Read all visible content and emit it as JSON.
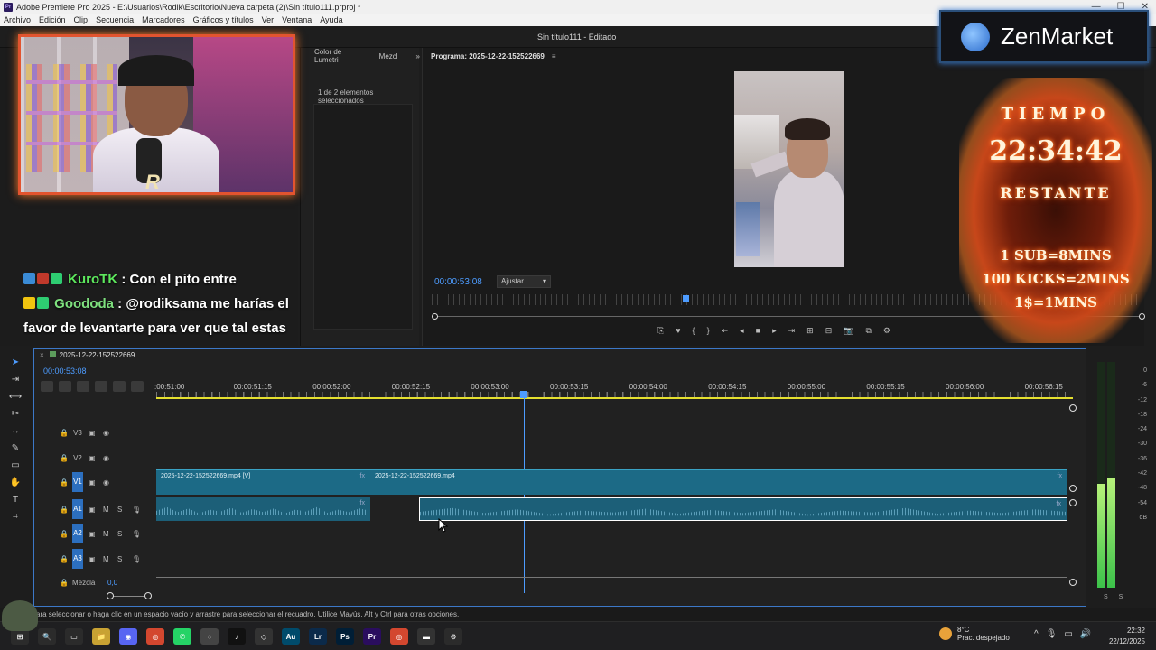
{
  "window": {
    "title": "Adobe Premiere Pro 2025 - E:\\Usuarios\\Rodik\\Escritorio\\Nueva carpeta (2)\\Sin título111.prproj *",
    "app_badge": "Pr",
    "controls": [
      "—",
      "☐",
      "✕"
    ]
  },
  "menu": [
    "Archivo",
    "Edición",
    "Clip",
    "Secuencia",
    "Marcadores",
    "Gráficos y títulos",
    "Ver",
    "Ventana",
    "Ayuda"
  ],
  "project_title": "Sin título111 - Editado",
  "mid_panel": {
    "tabs": [
      "Color de Lumetri",
      "Mezcl"
    ],
    "more": "»",
    "selection": "1 de 2 elementos seleccionados"
  },
  "program_monitor": {
    "header": "Programa: 2025-12-22-152522669",
    "menu_icon": "≡",
    "timecode": "00:00:53:08",
    "zoom_select": "Ajustar",
    "controls": [
      "⎘",
      "♥",
      "{",
      "}",
      "⇤",
      "◂",
      "■",
      "▸",
      "⇥",
      "⊞",
      "⊟",
      "📷",
      "⧉",
      "⚙"
    ]
  },
  "timeline": {
    "sequence_name": "2025-12-22-152522669",
    "close": "×",
    "timecode": "00:00:53:08",
    "ruler_labels": [
      ":00:51:00",
      "00:00:51:15",
      "00:00:52:00",
      "00:00:52:15",
      "00:00:53:00",
      "00:00:53:15",
      "00:00:54:00",
      "00:00:54:15",
      "00:00:55:00",
      "00:00:55:15",
      "00:00:56:00",
      "00:00:56:15"
    ],
    "tracks": [
      {
        "name": "V3",
        "active": false,
        "icons": [
          "▣",
          "◉"
        ]
      },
      {
        "name": "V2",
        "active": false,
        "icons": [
          "▣",
          "◉"
        ]
      },
      {
        "name": "V1",
        "active": true,
        "icons": [
          "▣",
          "◉"
        ]
      },
      {
        "name": "A1",
        "active": true,
        "icons": [
          "▣",
          "M",
          "S",
          "🎙"
        ]
      },
      {
        "name": "A2",
        "active": true,
        "icons": [
          "▣",
          "M",
          "S",
          "🎙"
        ]
      },
      {
        "name": "A3",
        "active": true,
        "icons": [
          "▣",
          "M",
          "S",
          "🎙"
        ]
      }
    ],
    "mix_label": "Mezcla",
    "mix_value": "0,0",
    "clips": {
      "v1_a": "2025-12-22-152522669.mp4 [V]",
      "v1_b": "2025-12-22-152522669.mp4",
      "fx": "fx"
    }
  },
  "meters": {
    "scale": [
      "0",
      "-6",
      "-12",
      "-18",
      "-24",
      "-30",
      "-36",
      "-42",
      "-48",
      "-54",
      "dB"
    ],
    "solo": [
      "S",
      "S"
    ],
    "left_level": 0.46,
    "right_level": 0.49
  },
  "status": "ara seleccionar o haga clic en un espacio vacío y arrastre para seleccionar el recuadro. Utilice Mayús, Alt y Ctrl para otras opciones.",
  "chat": [
    {
      "user": "KuroTK",
      "message": " : Con el pito entre"
    },
    {
      "user": "Goododa",
      "message": " : @rodiksama me harías el favor de levantarte para ver que tal estas"
    }
  ],
  "sponsor": {
    "name": "ZenMarket"
  },
  "overlay": {
    "line1": "TIEMPO",
    "time": "22:34:42",
    "line2": "RESTANTE",
    "rules": [
      "1 SUB=8MINS",
      "100 KICKS=2MINS",
      "1$=1MINS"
    ]
  },
  "taskbar": {
    "apps": [
      {
        "label": "⊞",
        "color": "#2b2b2b"
      },
      {
        "label": "🔍",
        "color": "#2b2b2b"
      },
      {
        "label": "▭",
        "color": "#2b2b2b"
      },
      {
        "label": "📁",
        "color": "#c8a233"
      },
      {
        "label": "◉",
        "color": "#5865f2"
      },
      {
        "label": "◎",
        "color": "#d3472f"
      },
      {
        "label": "✆",
        "color": "#25d366"
      },
      {
        "label": "◌",
        "color": "#444444"
      },
      {
        "label": "♪",
        "color": "#111111"
      },
      {
        "label": "◇",
        "color": "#333333"
      },
      {
        "label": "Au",
        "color": "#004b6b"
      },
      {
        "label": "Lr",
        "color": "#0b2a4a"
      },
      {
        "label": "Ps",
        "color": "#001e36"
      },
      {
        "label": "Pr",
        "color": "#2a0d5e"
      },
      {
        "label": "◎",
        "color": "#d3472f"
      },
      {
        "label": "▬",
        "color": "#333333"
      },
      {
        "label": "⚙",
        "color": "#2b2b2b"
      }
    ],
    "weather_temp": "8°C",
    "weather_desc": "Prac. despejado",
    "time": "22:32",
    "date": "22/12/2025"
  },
  "colors": {
    "accent": "#4d9cff",
    "clip": "#1c6a86",
    "fire": "#c7471a",
    "chat_user": "#5de85d"
  }
}
